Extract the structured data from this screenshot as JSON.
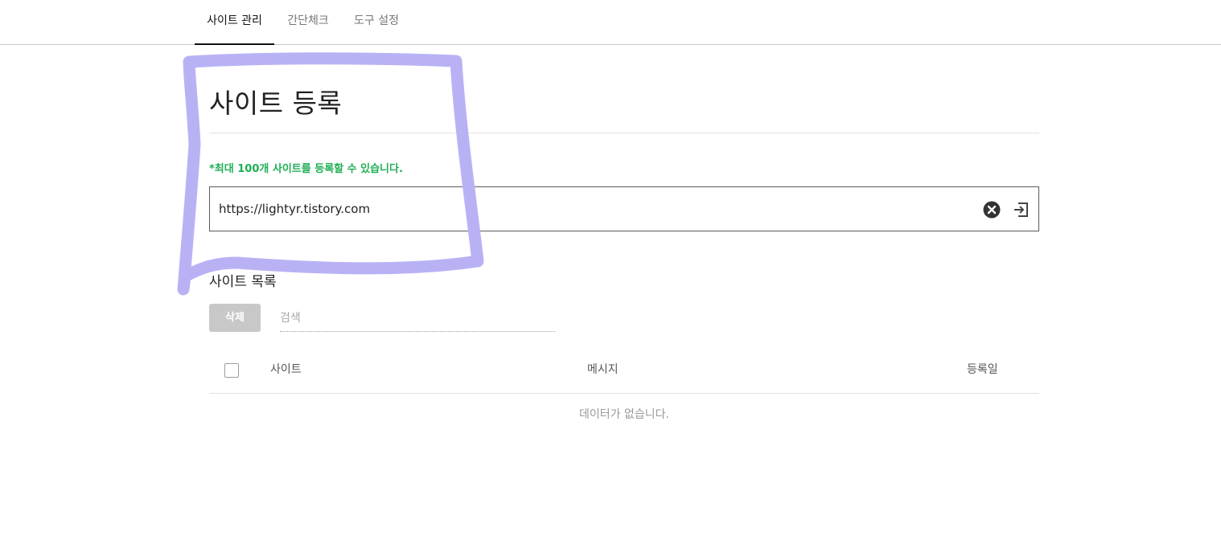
{
  "tabs": [
    {
      "label": "사이트 관리",
      "active": true
    },
    {
      "label": "간단체크",
      "active": false
    },
    {
      "label": "도구 설정",
      "active": false
    }
  ],
  "register": {
    "title": "사이트 등록",
    "notice": "*최대 100개 사이트를 등록할 수 있습니다.",
    "url_value": "https://lightyr.tistory.com",
    "clear_icon": "close-circle-icon",
    "submit_icon": "enter-icon"
  },
  "list": {
    "title": "사이트 목록",
    "delete_label": "삭제",
    "search_placeholder": "검색",
    "columns": {
      "site": "사이트",
      "message": "메시지",
      "date": "등록일"
    },
    "empty_message": "데이터가 없습니다."
  },
  "colors": {
    "notice_green": "#1fae55",
    "annotation_stroke": "#b8b2f5",
    "delete_button_bg": "#c8c8c8"
  }
}
